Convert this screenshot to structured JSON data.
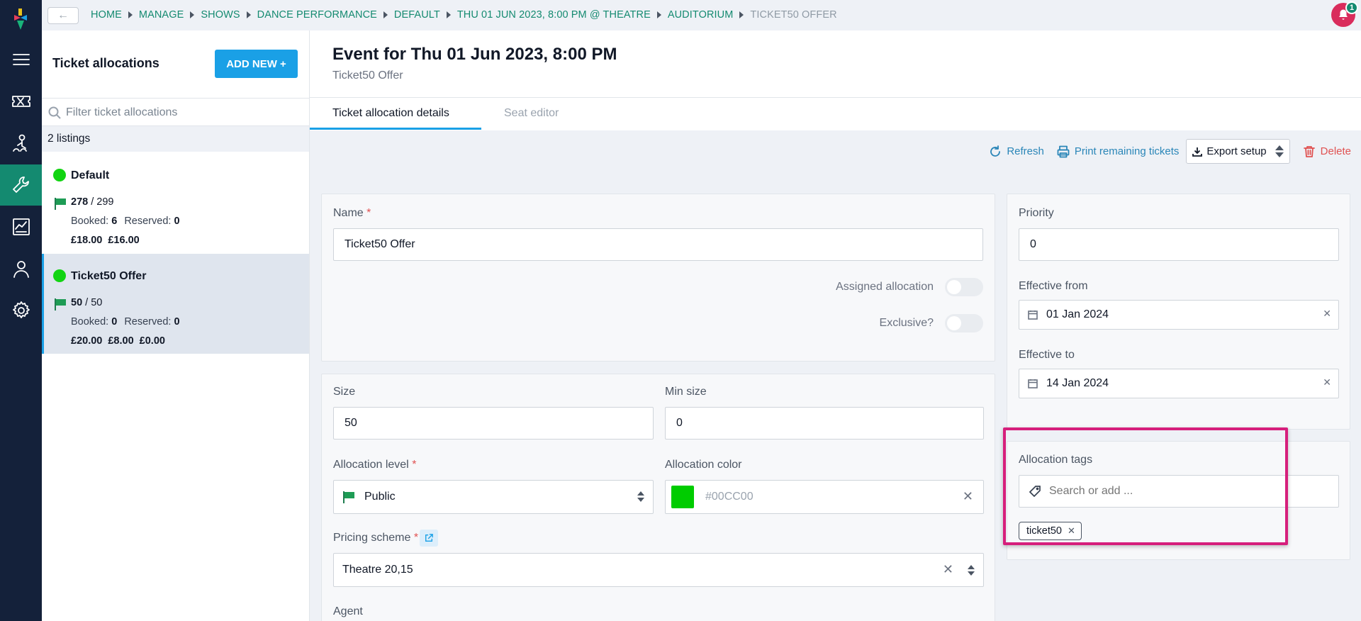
{
  "breadcrumb": [
    "HOME",
    "MANAGE",
    "SHOWS",
    "DANCE PERFORMANCE",
    "DEFAULT",
    "THU 01 JUN 2023, 8:00 PM @ THEATRE",
    "AUDITORIUM",
    "TICKET50 OFFER"
  ],
  "notifications": {
    "count": "1"
  },
  "list": {
    "title": "Ticket allocations",
    "add_button": "ADD NEW +",
    "filter_placeholder": "Filter ticket allocations",
    "listings_count": "2 listings",
    "items": [
      {
        "name": "Default",
        "available": "278",
        "total": "/ 299",
        "booked_label": "Booked:",
        "booked": "6",
        "reserved_label": "Reserved:",
        "reserved": "0",
        "prices": [
          "£18.00",
          "£16.00"
        ]
      },
      {
        "name": "Ticket50 Offer",
        "available": "50",
        "total": "/ 50",
        "booked_label": "Booked:",
        "booked": "0",
        "reserved_label": "Reserved:",
        "reserved": "0",
        "prices": [
          "£20.00",
          "£8.00",
          "£0.00"
        ]
      }
    ]
  },
  "event": {
    "title": "Event for Thu 01 Jun 2023, 8:00 PM",
    "subtitle": "Ticket50 Offer"
  },
  "tabs": [
    "Ticket allocation details",
    "Seat editor"
  ],
  "actions": {
    "refresh": "Refresh",
    "print": "Print remaining tickets",
    "export": "Export setup",
    "delete": "Delete"
  },
  "form": {
    "name_label": "Name",
    "name_value": "Ticket50 Offer",
    "assigned_label": "Assigned allocation",
    "exclusive_label": "Exclusive?",
    "size_label": "Size",
    "size_value": "50",
    "min_size_label": "Min size",
    "min_size_value": "0",
    "level_label": "Allocation level",
    "level_value": "Public",
    "color_label": "Allocation color",
    "color_value": "#00CC00",
    "pricing_label": "Pricing scheme",
    "pricing_value": "Theatre 20,15",
    "agent_label": "Agent",
    "priority_label": "Priority",
    "priority_value": "0",
    "effective_from_label": "Effective from",
    "effective_from_value": "01 Jan 2024",
    "effective_to_label": "Effective to",
    "effective_to_value": "14 Jan 2024",
    "tags_label": "Allocation tags",
    "tags_placeholder": "Search or add ...",
    "tags": [
      "ticket50"
    ]
  },
  "colors": {
    "accent": "#1aa0e6",
    "brand_green": "#148a70",
    "rail": "#14213a",
    "status_green": "#12d412",
    "highlight": "#d61f7c",
    "allocation_color": "#00CC00"
  }
}
